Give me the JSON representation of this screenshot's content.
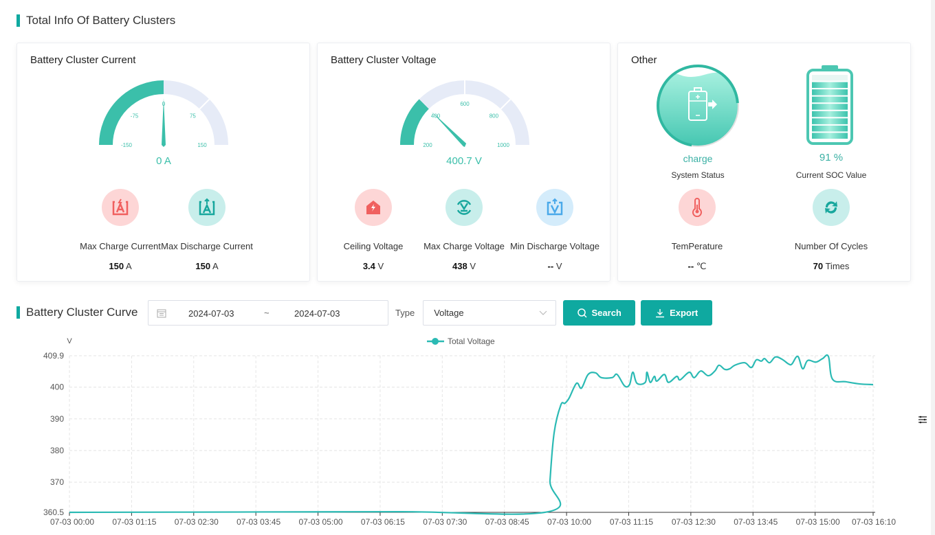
{
  "header": {
    "title": "Total Info Of Battery Clusters"
  },
  "current_card": {
    "title": "Battery Cluster Current",
    "gauge": {
      "min": -150,
      "max": 150,
      "value": 0,
      "unit": "A",
      "display": "0 A",
      "ticks": [
        "-150",
        "-75",
        "0",
        "75",
        "150"
      ]
    },
    "metrics": [
      {
        "icon": "charge-current-icon",
        "label": "Max Charge Current",
        "value": "150",
        "unit": "A"
      },
      {
        "icon": "discharge-current-icon",
        "label": "Max Discharge Current",
        "value": "150",
        "unit": "A"
      }
    ]
  },
  "voltage_card": {
    "title": "Battery Cluster Voltage",
    "gauge": {
      "min": 200,
      "max": 1000,
      "value": 400.7,
      "unit": "V",
      "display": "400.7 V",
      "ticks": [
        "200",
        "400",
        "600",
        "800",
        "1000"
      ]
    },
    "metrics": [
      {
        "icon": "ceiling-voltage-icon",
        "label": "Ceiling Voltage",
        "value": "3.4",
        "unit": "V"
      },
      {
        "icon": "max-charge-voltage-icon",
        "label": "Max Charge Voltage",
        "value": "438",
        "unit": "V"
      },
      {
        "icon": "min-discharge-voltage-icon",
        "label": "Min Discharge Voltage",
        "value": "--",
        "unit": "V"
      }
    ]
  },
  "other_card": {
    "title": "Other",
    "status": {
      "value": "charge",
      "label": "System Status"
    },
    "soc": {
      "value": "91 %",
      "percent": 91,
      "label": "Current SOC Value"
    },
    "temperature": {
      "label": "TemPerature",
      "value": "--",
      "unit": "℃"
    },
    "cycles": {
      "label": "Number Of Cycles",
      "value": "70",
      "unit": "Times"
    }
  },
  "curve": {
    "title": "Battery Cluster Curve",
    "date_start": "2024-07-03",
    "date_end": "2024-07-03",
    "date_separator": "~",
    "type_label": "Type",
    "type_value": "Voltage",
    "search_label": "Search",
    "export_label": "Export"
  },
  "colors": {
    "accent": "#0fa9a0",
    "gauge_fill": "#3bbfaa",
    "gauge_track": "#e6ebf7",
    "line": "#2bbab4"
  },
  "chart_data": {
    "type": "line",
    "title": "",
    "ylabel": "V",
    "xlabel": "",
    "legend": [
      "Total Voltage"
    ],
    "legend_position": "top-center",
    "ylim": [
      360.5,
      409.9
    ],
    "yticks": [
      "409.9",
      "400",
      "390",
      "380",
      "370",
      "360.5"
    ],
    "ytick_values": [
      409.9,
      400,
      390,
      380,
      370,
      360.5
    ],
    "xlim_minutes": [
      0,
      970
    ],
    "xticks": [
      "07-03 00:00",
      "07-03 01:15",
      "07-03 02:30",
      "07-03 03:45",
      "07-03 05:00",
      "07-03 06:15",
      "07-03 07:30",
      "07-03 08:45",
      "07-03 10:00",
      "07-03 11:15",
      "07-03 12:30",
      "07-03 13:45",
      "07-03 15:00",
      "07-03 16:10"
    ],
    "xtick_minutes": [
      0,
      75,
      150,
      225,
      300,
      375,
      450,
      525,
      600,
      675,
      750,
      825,
      900,
      970
    ],
    "grid": true,
    "series": [
      {
        "name": "Total Voltage",
        "x_minutes": [
          0,
          200,
          400,
          578,
          580,
          585,
          593,
          598,
          603,
          612,
          618,
          626,
          635,
          642,
          655,
          661,
          670,
          676,
          680,
          685,
          695,
          697,
          701,
          706,
          709,
          718,
          723,
          733,
          737,
          748,
          754,
          762,
          771,
          779,
          784,
          791,
          797,
          803,
          815,
          823,
          829,
          835,
          839,
          845,
          852,
          860,
          868,
          872,
          879,
          885,
          891,
          901,
          909,
          916,
          921,
          937,
          954,
          970
        ],
        "values": [
          360.5,
          360.6,
          360.7,
          360.7,
          370.5,
          385.6,
          394.3,
          394.9,
          396.5,
          401.2,
          399.7,
          404.0,
          404.5,
          403.0,
          403.0,
          404.0,
          400.4,
          400.8,
          404.7,
          401.2,
          401.5,
          404.7,
          401.5,
          403.4,
          401.9,
          404.0,
          401.5,
          403.4,
          402.3,
          404.7,
          403.0,
          405.1,
          403.6,
          405.1,
          406.9,
          405.6,
          405.8,
          406.9,
          407.7,
          406.2,
          408.6,
          408.2,
          409.0,
          407.7,
          409.5,
          408.8,
          407.3,
          407.3,
          409.7,
          405.8,
          408.4,
          407.9,
          409.0,
          409.7,
          402.5,
          401.7,
          401.0,
          400.8
        ]
      }
    ]
  }
}
